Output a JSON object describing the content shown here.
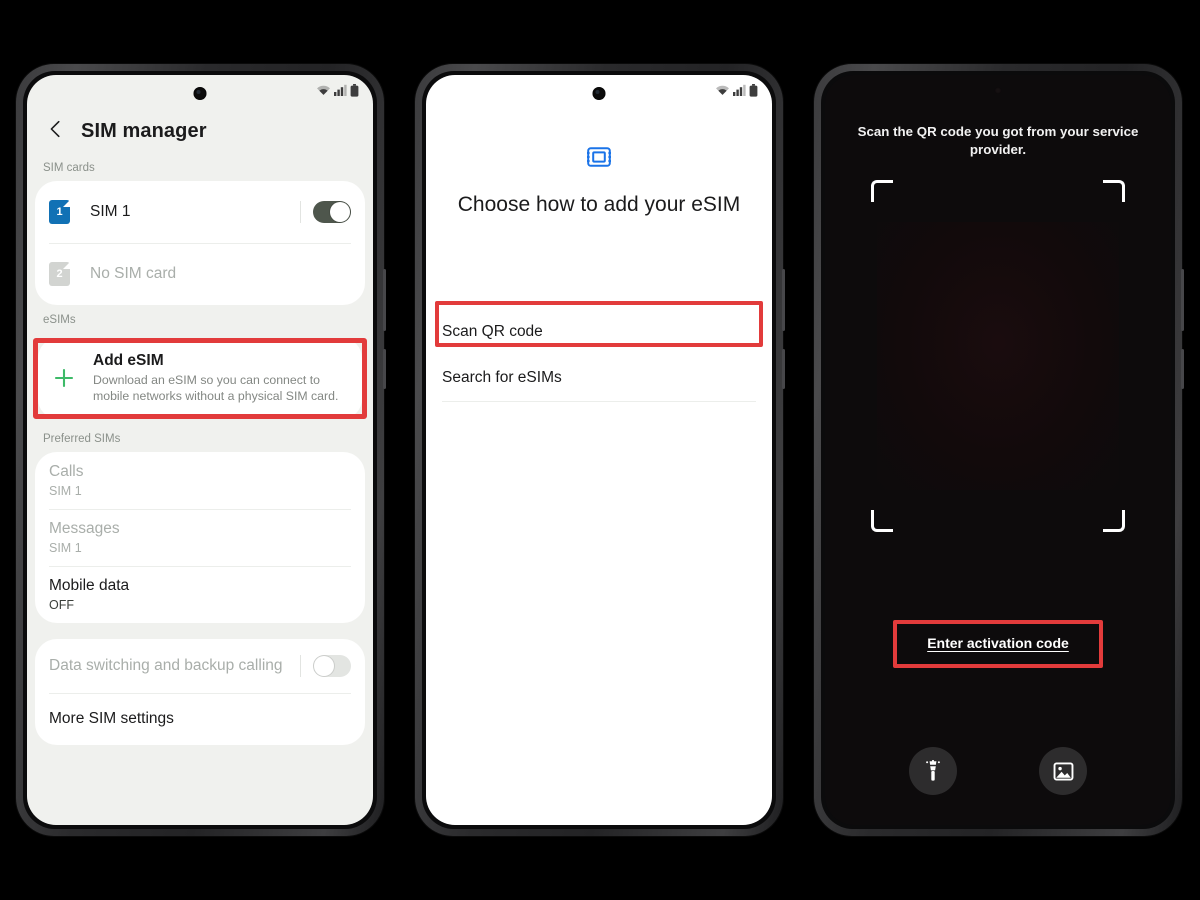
{
  "meta": {
    "background_color": "#000000",
    "highlight_color": "#e23b3b",
    "accent_blue": "#1171b5",
    "accent_green": "#3dba68",
    "esim_icon_blue": "#1a73e8"
  },
  "statusbar": {
    "wifi_icon": "wifi-icon",
    "signal_icon": "signal-bars-icon",
    "battery_icon": "battery-icon"
  },
  "phone1": {
    "name": "sim-manager-screen",
    "appbar": {
      "back_icon": "back-chevron-icon",
      "title": "SIM manager"
    },
    "sections": [
      {
        "label": "SIM cards",
        "rows": [
          {
            "badge": "1",
            "badge_style": "blue",
            "title": "SIM 1",
            "toggle": "on"
          },
          {
            "badge": "2",
            "badge_style": "gray",
            "title": "No SIM card",
            "toggle": null
          }
        ]
      },
      {
        "label": "eSIMs",
        "highlighted": true,
        "add_esim": {
          "icon": "plus-icon",
          "title": "Add eSIM",
          "description": "Download an eSIM so you can connect to mobile networks without a physical SIM card."
        }
      },
      {
        "label": "Preferred SIMs",
        "rows": [
          {
            "title": "Calls",
            "value": "SIM 1",
            "disabled": true
          },
          {
            "title": "Messages",
            "value": "SIM 1",
            "disabled": true
          },
          {
            "title": "Mobile data",
            "value": "OFF",
            "disabled": false
          }
        ]
      },
      {
        "label": "",
        "rows": [
          {
            "title": "Data switching and backup calling",
            "toggle": "off",
            "disabled": true
          },
          {
            "title": "More SIM settings",
            "toggle": null,
            "disabled": false
          }
        ]
      }
    ]
  },
  "phone2": {
    "name": "choose-how-to-add-esim-screen",
    "hero_icon": "esim-chip-icon",
    "heading": "Choose how to add your eSIM",
    "options": [
      {
        "label": "Scan QR code",
        "highlighted": true
      },
      {
        "label": "Search for eSIMs",
        "highlighted": false
      }
    ]
  },
  "phone3": {
    "name": "qr-scanner-screen",
    "hint": "Scan the QR code you got from your service provider.",
    "viewfinder_icon": "scanner-frame-corners",
    "activation_link": "Enter activation code",
    "tools": [
      {
        "icon": "flashlight-icon",
        "name": "flashlight-button"
      },
      {
        "icon": "gallery-icon",
        "name": "gallery-button"
      }
    ]
  }
}
